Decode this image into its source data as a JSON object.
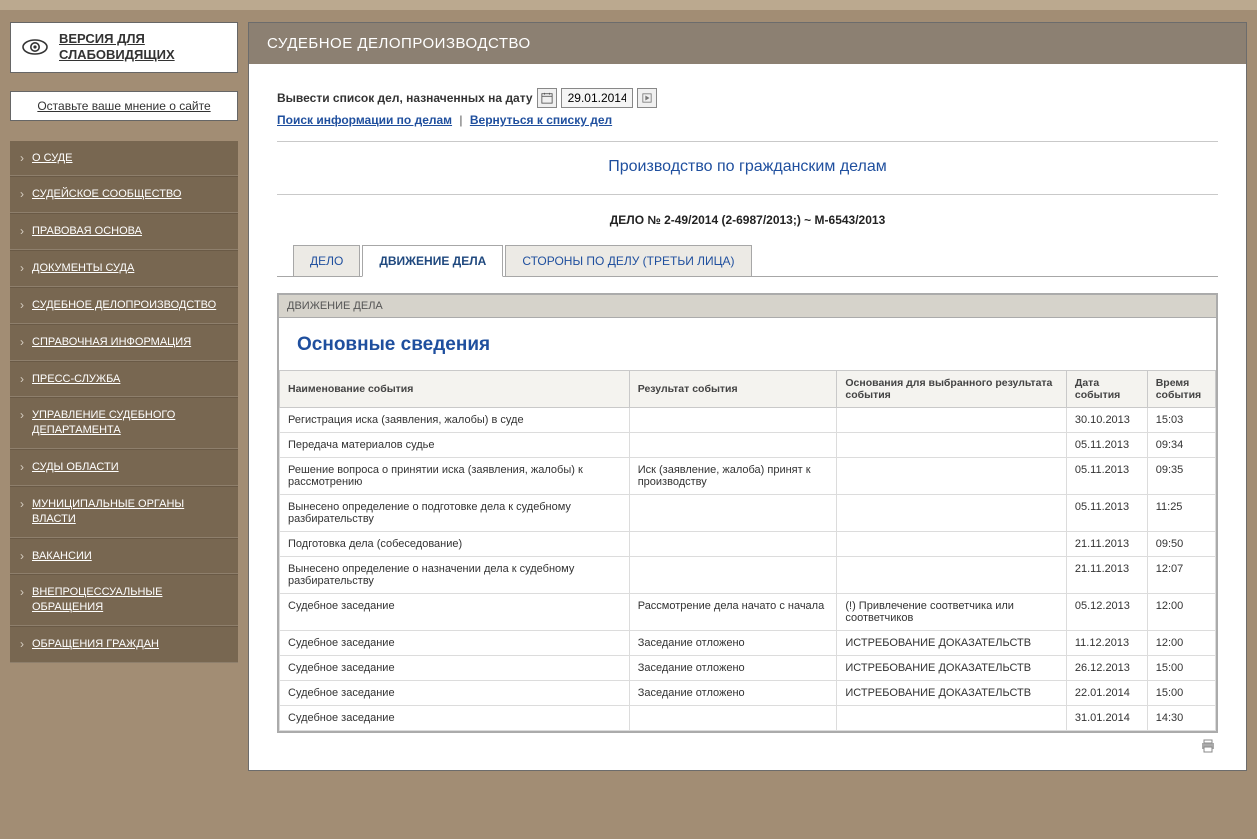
{
  "left": {
    "vision": "ВЕРСИЯ ДЛЯ СЛАБОВИДЯЩИХ",
    "feedback": "Оставьте ваше мнение о сайте",
    "menu": [
      "О СУДЕ",
      "СУДЕЙСКОЕ СООБЩЕСТВО",
      "ПРАВОВАЯ ОСНОВА",
      "ДОКУМЕНТЫ СУДА",
      "СУДЕБНОЕ ДЕЛОПРОИЗВОДСТВО",
      "СПРАВОЧНАЯ ИНФОРМАЦИЯ",
      "ПРЕСС-СЛУЖБА",
      "УПРАВЛЕНИЕ СУДЕБНОГО ДЕПАРТАМЕНТА",
      "СУДЫ ОБЛАСТИ",
      "МУНИЦИПАЛЬНЫЕ ОРГАНЫ ВЛАСТИ",
      "ВАКАНСИИ",
      "ВНЕПРОЦЕССУАЛЬНЫЕ ОБРАЩЕНИЯ",
      "ОБРАЩЕНИЯ ГРАЖДАН"
    ]
  },
  "main": {
    "panel_title": "СУДЕБНОЕ ДЕЛОПРОИЗВОДСТВО",
    "date_label": "Вывести список дел, назначенных на дату",
    "date_value": "29.01.2014",
    "links": {
      "search": "Поиск информации по делам",
      "back": "Вернуться к списку дел"
    },
    "section_title": "Производство по гражданским делам",
    "case_number": "ДЕЛО № 2-49/2014 (2-6987/2013;) ~ М-6543/2013",
    "tabs": [
      {
        "label": "ДЕЛО",
        "active": false
      },
      {
        "label": "ДВИЖЕНИЕ ДЕЛА",
        "active": true
      },
      {
        "label": "СТОРОНЫ ПО ДЕЛУ (ТРЕТЬИ ЛИЦА)",
        "active": false
      }
    ],
    "card": {
      "header": "ДВИЖЕНИЕ ДЕЛА",
      "title": "Основные сведения",
      "columns": [
        "Наименование события",
        "Результат события",
        "Основания для выбранного результата события",
        "Дата события",
        "Время события"
      ],
      "rows": [
        {
          "c1": "Регистрация иска (заявления, жалобы) в суде",
          "c2": "",
          "c3": "",
          "c4": "30.10.2013",
          "c5": "15:03"
        },
        {
          "c1": "Передача материалов судье",
          "c2": "",
          "c3": "",
          "c4": "05.11.2013",
          "c5": "09:34"
        },
        {
          "c1": "Решение вопроса о принятии иска (заявления, жалобы) к рассмотрению",
          "c2": "Иск (заявление, жалоба) принят к производству",
          "c3": "",
          "c4": "05.11.2013",
          "c5": "09:35"
        },
        {
          "c1": "Вынесено определение о подготовке дела к судебному разбирательству",
          "c2": "",
          "c3": "",
          "c4": "05.11.2013",
          "c5": "11:25"
        },
        {
          "c1": "Подготовка дела (собеседование)",
          "c2": "",
          "c3": "",
          "c4": "21.11.2013",
          "c5": "09:50"
        },
        {
          "c1": "Вынесено определение о назначении дела к судебному разбирательству",
          "c2": "",
          "c3": "",
          "c4": "21.11.2013",
          "c5": "12:07"
        },
        {
          "c1": "Судебное заседание",
          "c2": "Рассмотрение дела начато с начала",
          "c3": "(!) Привлечение соответчика или соответчиков",
          "c4": "05.12.2013",
          "c5": "12:00"
        },
        {
          "c1": "Судебное заседание",
          "c2": "Заседание отложено",
          "c3": "ИСТРЕБОВАНИЕ ДОКАЗАТЕЛЬСТВ",
          "c4": "11.12.2013",
          "c5": "12:00"
        },
        {
          "c1": "Судебное заседание",
          "c2": "Заседание отложено",
          "c3": "ИСТРЕБОВАНИЕ ДОКАЗАТЕЛЬСТВ",
          "c4": "26.12.2013",
          "c5": "15:00"
        },
        {
          "c1": "Судебное заседание",
          "c2": "Заседание отложено",
          "c3": "ИСТРЕБОВАНИЕ ДОКАЗАТЕЛЬСТВ",
          "c4": "22.01.2014",
          "c5": "15:00"
        },
        {
          "c1": "Судебное заседание",
          "c2": "",
          "c3": "",
          "c4": "31.01.2014",
          "c5": "14:30"
        }
      ]
    }
  }
}
